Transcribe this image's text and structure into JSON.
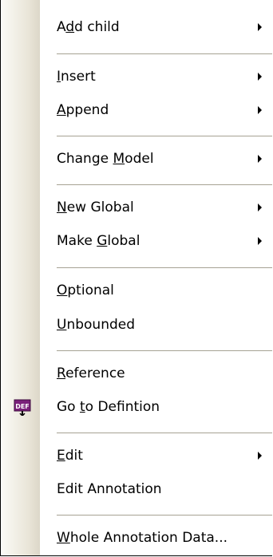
{
  "menu": {
    "items": [
      {
        "pre": "A",
        "u": "d",
        "post": "d child",
        "submenu": true
      },
      {
        "pre": "",
        "u": "I",
        "post": "nsert",
        "submenu": true
      },
      {
        "pre": "",
        "u": "A",
        "post": "ppend",
        "submenu": true
      },
      {
        "pre": "Change ",
        "u": "M",
        "post": "odel",
        "submenu": true
      },
      {
        "pre": "",
        "u": "N",
        "post": "ew Global",
        "submenu": true
      },
      {
        "pre": "Make ",
        "u": "G",
        "post": "lobal",
        "submenu": true
      },
      {
        "pre": "",
        "u": "O",
        "post": "ptional",
        "submenu": false
      },
      {
        "pre": "",
        "u": "U",
        "post": "nbounded",
        "submenu": false
      },
      {
        "pre": "",
        "u": "R",
        "post": "eference",
        "submenu": false
      },
      {
        "pre": "Go ",
        "u": "t",
        "post": "o Defintion",
        "submenu": false,
        "icon": "def-goto-icon",
        "icon_text": "DEF"
      },
      {
        "pre": "",
        "u": "E",
        "post": "dit",
        "submenu": true
      },
      {
        "pre": "Edit Annotation",
        "u": "",
        "post": "",
        "submenu": false
      },
      {
        "pre": "",
        "u": "W",
        "post": "hole Annotation Data...",
        "submenu": false
      }
    ]
  },
  "colors": {
    "separator": "#a6a293",
    "gutter": "#e9e5d8",
    "icon_purple": "#7a1f7a"
  }
}
